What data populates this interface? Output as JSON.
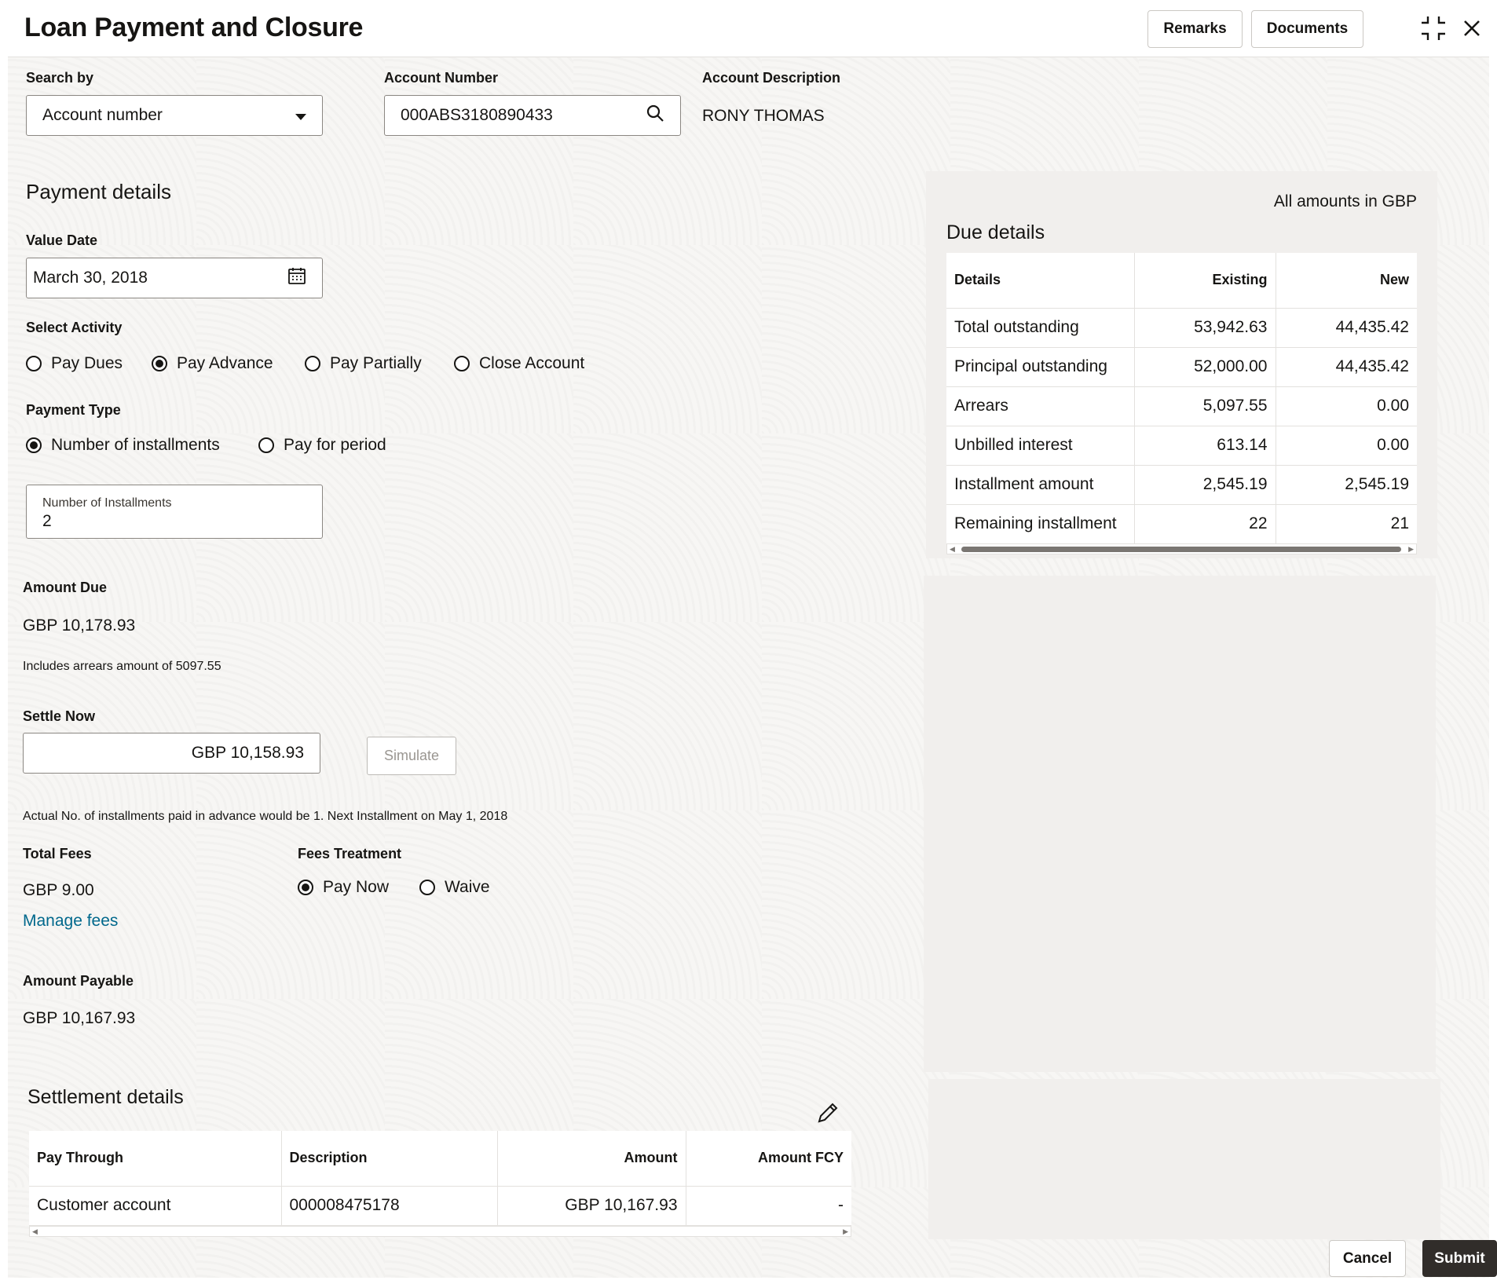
{
  "header": {
    "title": "Loan Payment and Closure",
    "remarks_label": "Remarks",
    "documents_label": "Documents"
  },
  "search": {
    "search_by_label": "Search by",
    "search_by_value": "Account number",
    "account_number_label": "Account Number",
    "account_number_value": "000ABS3180890433",
    "account_description_label": "Account Description",
    "account_description_value": "RONY THOMAS"
  },
  "payment": {
    "section_title": "Payment details",
    "value_date_label": "Value Date",
    "value_date": "March 30, 2018",
    "select_activity_label": "Select Activity",
    "activities": [
      {
        "label": "Pay Dues",
        "selected": false
      },
      {
        "label": "Pay Advance",
        "selected": true
      },
      {
        "label": "Pay Partially",
        "selected": false
      },
      {
        "label": "Close Account",
        "selected": false
      }
    ],
    "payment_type_label": "Payment Type",
    "payment_types": [
      {
        "label": "Number of installments",
        "selected": true
      },
      {
        "label": "Pay for period",
        "selected": false
      }
    ],
    "installments_label": "Number of Installments",
    "installments_value": "2",
    "amount_due_label": "Amount Due",
    "amount_due": "GBP 10,178.93",
    "arrears_note": "Includes arrears amount of 5097.55",
    "settle_now_label": "Settle Now",
    "settle_now_value": "GBP 10,158.93",
    "simulate_label": "Simulate",
    "advance_note": "Actual No. of installments paid in advance would be 1. Next Installment on May 1, 2018",
    "total_fees_label": "Total Fees",
    "total_fees": "GBP 9.00",
    "manage_fees_label": "Manage fees",
    "fees_treatment_label": "Fees Treatment",
    "fees_treatment": [
      {
        "label": "Pay Now",
        "selected": true
      },
      {
        "label": "Waive",
        "selected": false
      }
    ],
    "amount_payable_label": "Amount Payable",
    "amount_payable": "GBP 10,167.93"
  },
  "due_details": {
    "currency_note": "All amounts in GBP",
    "title": "Due details",
    "columns": [
      "Details",
      "Existing",
      "New"
    ],
    "rows": [
      [
        "Total outstanding",
        "53,942.63",
        "44,435.42"
      ],
      [
        "Principal outstanding",
        "52,000.00",
        "44,435.42"
      ],
      [
        "Arrears",
        "5,097.55",
        "0.00"
      ],
      [
        "Unbilled interest",
        "613.14",
        "0.00"
      ],
      [
        "Installment amount",
        "2,545.19",
        "2,545.19"
      ],
      [
        "Remaining installment",
        "22",
        "21"
      ]
    ]
  },
  "settlement": {
    "title": "Settlement details",
    "columns": [
      "Pay Through",
      "Description",
      "Amount",
      "Amount FCY"
    ],
    "rows": [
      [
        "Customer account",
        "000008475178",
        "GBP 10,167.93",
        "-"
      ]
    ]
  },
  "footer": {
    "cancel_label": "Cancel",
    "submit_label": "Submit"
  }
}
